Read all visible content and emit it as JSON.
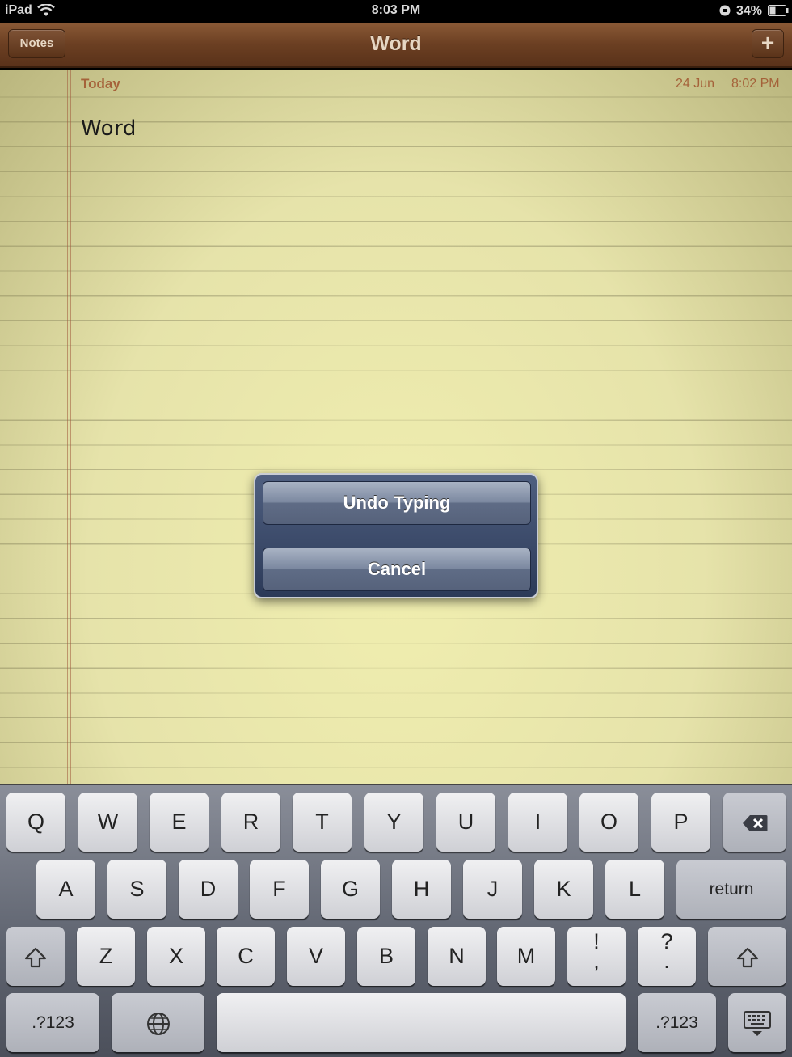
{
  "status_bar": {
    "device": "iPad",
    "time": "8:03 PM",
    "battery": "34%"
  },
  "nav": {
    "back_label": "Notes",
    "title": "Word",
    "add_label": "+"
  },
  "note": {
    "day": "Today",
    "date": "24 Jun",
    "time": "8:02 PM",
    "body": "Word"
  },
  "action_sheet": {
    "undo_label": "Undo Typing",
    "cancel_label": "Cancel"
  },
  "keyboard": {
    "row1": [
      "Q",
      "W",
      "E",
      "R",
      "T",
      "Y",
      "U",
      "I",
      "O",
      "P"
    ],
    "row2": [
      "A",
      "S",
      "D",
      "F",
      "G",
      "H",
      "J",
      "K",
      "L"
    ],
    "return_label": "return",
    "row3": [
      "Z",
      "X",
      "C",
      "V",
      "B",
      "N",
      "M"
    ],
    "excl_top": "!",
    "excl_bottom": ",",
    "quest_top": "?",
    "quest_bottom": ".",
    "numbers_label": ".?123"
  },
  "icons": [
    "wifi-icon",
    "lock-icon",
    "battery-icon",
    "backspace-icon",
    "shift-icon",
    "globe-icon",
    "keyboard-dismiss-icon"
  ]
}
